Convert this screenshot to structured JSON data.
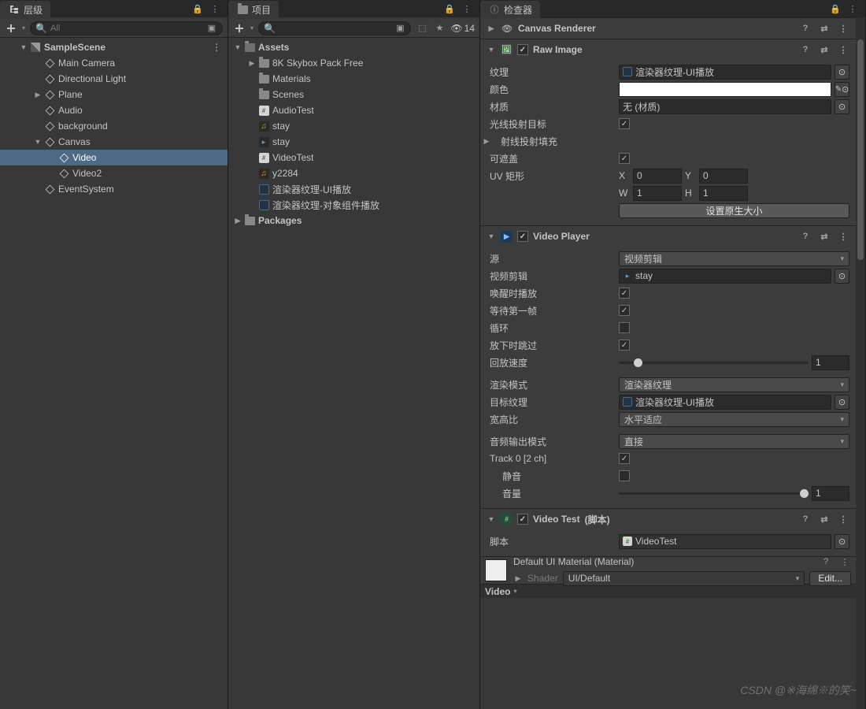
{
  "hierarchy": {
    "title": "层级",
    "search_placeholder": "All",
    "scene": "SampleScene",
    "items": [
      {
        "label": "Main Camera"
      },
      {
        "label": "Directional Light"
      },
      {
        "label": "Plane"
      },
      {
        "label": "Audio"
      },
      {
        "label": "background"
      },
      {
        "label": "Canvas"
      },
      {
        "label": "Video"
      },
      {
        "label": "Video2"
      },
      {
        "label": "EventSystem"
      }
    ]
  },
  "project": {
    "title": "项目",
    "hidden_count": "14",
    "root": "Assets",
    "items": [
      {
        "label": "8K Skybox Pack Free"
      },
      {
        "label": "Materials"
      },
      {
        "label": "Scenes"
      },
      {
        "label": "AudioTest"
      },
      {
        "label": "stay"
      },
      {
        "label": "stay"
      },
      {
        "label": "VideoTest"
      },
      {
        "label": "y2284"
      },
      {
        "label": "渲染器纹理-UI播放"
      },
      {
        "label": "渲染器纹理-对象组件播放"
      }
    ],
    "packages": "Packages"
  },
  "inspector": {
    "title": "检查器",
    "canvas_renderer": "Canvas Renderer",
    "raw_image": {
      "title": "Raw Image",
      "texture_label": "纹理",
      "texture_value": "渲染器纹理-UI播放",
      "color_label": "颜色",
      "material_label": "材质",
      "material_value": "无 (材质)",
      "raycast_target_label": "光线投射目标",
      "raycast_padding_label": "射线投射填充",
      "maskable_label": "可遮盖",
      "uv_rect_label": "UV 矩形",
      "uv_x": "0",
      "uv_y": "0",
      "uv_w": "1",
      "uv_h": "1",
      "native_size_btn": "设置原生大小"
    },
    "video_player": {
      "title": "Video Player",
      "source_label": "源",
      "source_value": "视频剪辑",
      "video_clip_label": "视频剪辑",
      "video_clip_value": "stay",
      "play_on_awake_label": "唤醒时播放",
      "wait_first_frame_label": "等待第一帧",
      "loop_label": "循环",
      "skip_on_drop_label": "放下时跳过",
      "playback_speed_label": "回放速度",
      "playback_speed_value": "1",
      "render_mode_label": "渲染模式",
      "render_mode_value": "渲染器纹理",
      "target_texture_label": "目标纹理",
      "target_texture_value": "渲染器纹理-UI播放",
      "aspect_ratio_label": "宽高比",
      "aspect_ratio_value": "水平适应",
      "audio_output_label": "音频输出模式",
      "audio_output_value": "直接",
      "track_label": "Track 0 [2 ch]",
      "mute_label": "静音",
      "volume_label": "音量",
      "volume_value": "1"
    },
    "video_test": {
      "title_a": "Video Test",
      "title_b": "(脚本)",
      "script_label": "脚本",
      "script_value": "VideoTest"
    },
    "material": {
      "title": "Default UI Material (Material)",
      "shader_label": "Shader",
      "shader_value": "UI/Default",
      "edit": "Edit..."
    },
    "preview_label": "Video"
  },
  "watermark": "CSDN @※海绵※的笑~"
}
